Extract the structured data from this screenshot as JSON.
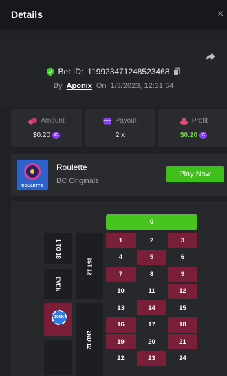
{
  "header": {
    "title": "Details",
    "close_glyph": "×"
  },
  "bet": {
    "id_label": "Bet ID:",
    "id_value": "119923471248523468",
    "by_label": "By",
    "user": "Aponix",
    "on_label": "On",
    "datetime": "1/3/2023, 12:31:54"
  },
  "stats": {
    "amount": {
      "label": "Amount",
      "value": "$0.20"
    },
    "payout": {
      "label": "Payout",
      "value": "2 x"
    },
    "profit": {
      "label": "Profit",
      "value": "$0.20"
    },
    "coin_symbol": "C"
  },
  "game": {
    "thumb_label": "ROULETTE",
    "name": "Roulette",
    "provider": "BC Originals",
    "play_label": "Play Now"
  },
  "board": {
    "zero": "0",
    "outside": {
      "low": "1 TO 18",
      "even": "EVEN"
    },
    "dozens": [
      "1ST 12",
      "2ND 12"
    ],
    "chip_label": "100K",
    "numbers": [
      {
        "n": "1",
        "color": "red"
      },
      {
        "n": "2",
        "color": "black"
      },
      {
        "n": "3",
        "color": "red"
      },
      {
        "n": "4",
        "color": "black"
      },
      {
        "n": "5",
        "color": "red"
      },
      {
        "n": "6",
        "color": "black"
      },
      {
        "n": "7",
        "color": "red"
      },
      {
        "n": "8",
        "color": "black"
      },
      {
        "n": "9",
        "color": "red"
      },
      {
        "n": "10",
        "color": "black"
      },
      {
        "n": "11",
        "color": "black"
      },
      {
        "n": "12",
        "color": "red"
      },
      {
        "n": "13",
        "color": "black"
      },
      {
        "n": "14",
        "color": "red"
      },
      {
        "n": "15",
        "color": "black"
      },
      {
        "n": "16",
        "color": "red"
      },
      {
        "n": "17",
        "color": "black"
      },
      {
        "n": "18",
        "color": "red"
      },
      {
        "n": "19",
        "color": "red"
      },
      {
        "n": "20",
        "color": "black"
      },
      {
        "n": "21",
        "color": "red"
      },
      {
        "n": "22",
        "color": "black"
      },
      {
        "n": "23",
        "color": "red"
      },
      {
        "n": "24",
        "color": "black"
      }
    ]
  },
  "colors": {
    "accent_green": "#3fbf19",
    "red_cell": "#7a1f3a",
    "coin": "#8a3ff5"
  }
}
